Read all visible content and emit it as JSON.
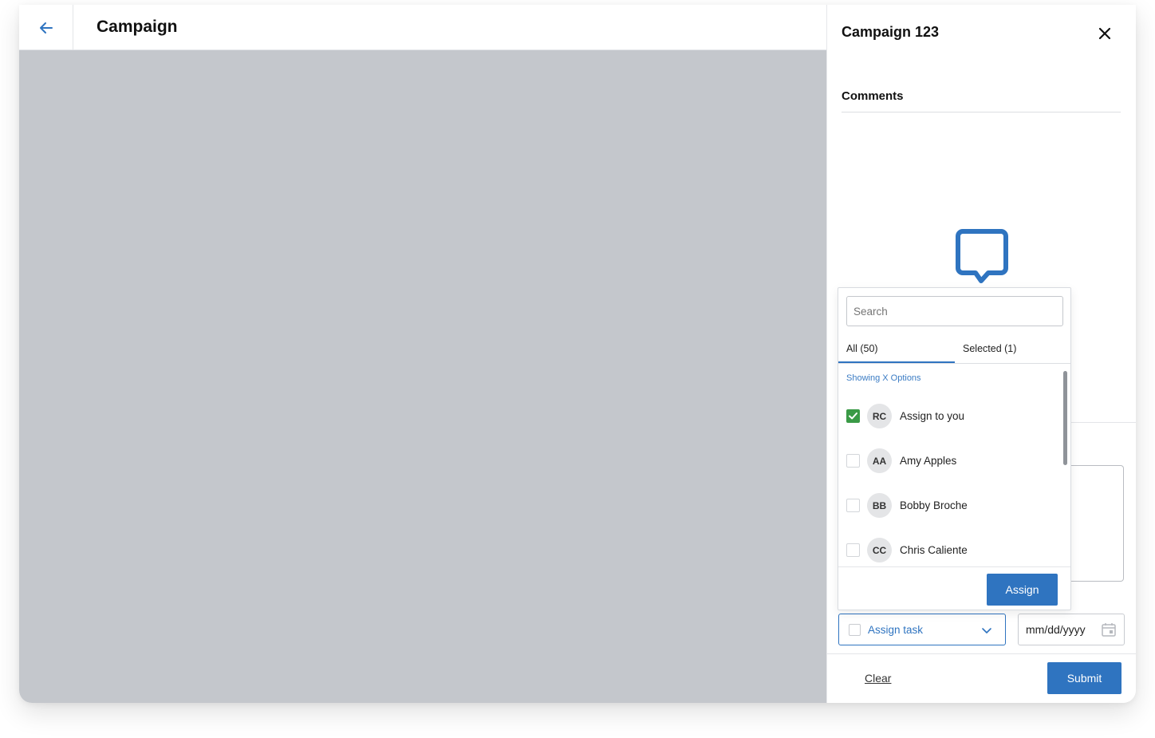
{
  "header": {
    "title": "Campaign"
  },
  "panel": {
    "title": "Campaign 123",
    "tab": "Comments",
    "assign_task_label": "Assign task",
    "date_placeholder": "mm/dd/yyyy",
    "clear_label": "Clear",
    "submit_label": "Submit"
  },
  "dropdown": {
    "search_placeholder": "Search",
    "tab_all": "All (50)",
    "tab_selected": "Selected  (1)",
    "showing_text": "Showing X Options",
    "options": [
      {
        "initials": "RC",
        "name": "Assign to you",
        "checked": true
      },
      {
        "initials": "AA",
        "name": "Amy Apples",
        "checked": false
      },
      {
        "initials": "BB",
        "name": "Bobby Broche",
        "checked": false
      },
      {
        "initials": "CC",
        "name": "Chris Caliente",
        "checked": false
      }
    ],
    "assign_label": "Assign"
  },
  "colors": {
    "accent": "#2f74c0",
    "check": "#3a9a46",
    "overlay": "#c4c7cc"
  },
  "icons": [
    "back-arrow-icon",
    "close-icon",
    "comment-icon",
    "chevron-down-icon",
    "calendar-icon",
    "checkmark-icon"
  ]
}
